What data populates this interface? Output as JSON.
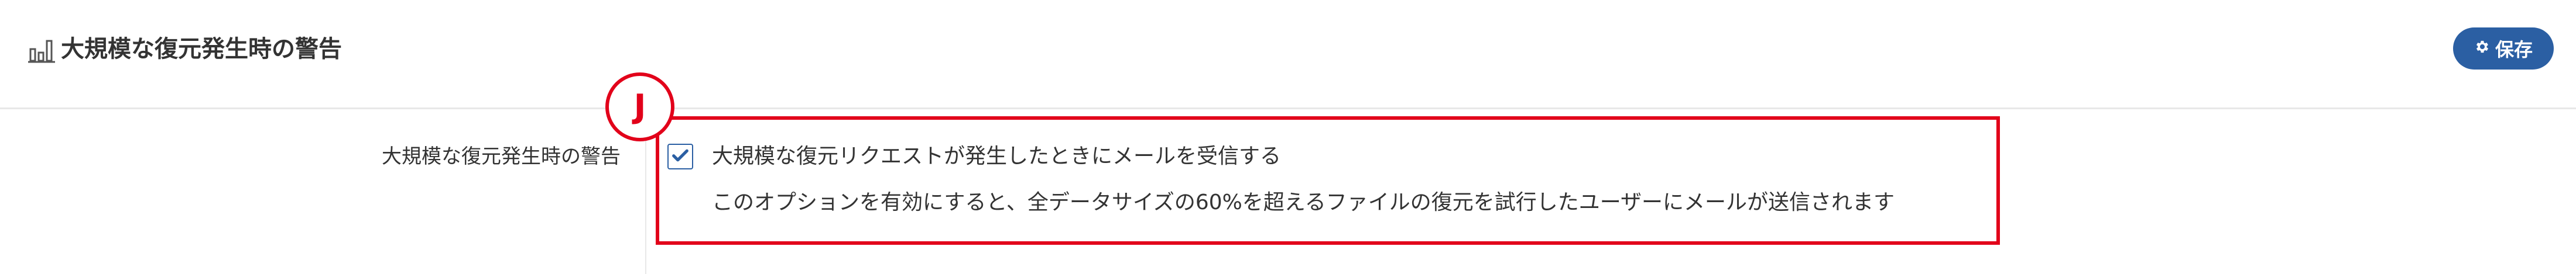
{
  "header": {
    "icon": "bar-chart-icon",
    "title": "大規模な復元発生時の警告",
    "save_label": "保存",
    "save_icon": "gear-icon"
  },
  "form": {
    "row_label": "大規模な復元発生時の警告",
    "checkbox_checked": true,
    "checkbox_label": "大規模な復元リクエストが発生したときにメールを受信する",
    "help_text": "このオプションを有効にすると、全データサイズの60%を超えるファイルの復元を試行したユーザーにメールが送信されます"
  },
  "annotation": {
    "badge_label": "J"
  },
  "colors": {
    "accent": "#2b5fa3",
    "annotation": "#e2001a",
    "text": "#333333",
    "divider": "#e8e8e8"
  }
}
